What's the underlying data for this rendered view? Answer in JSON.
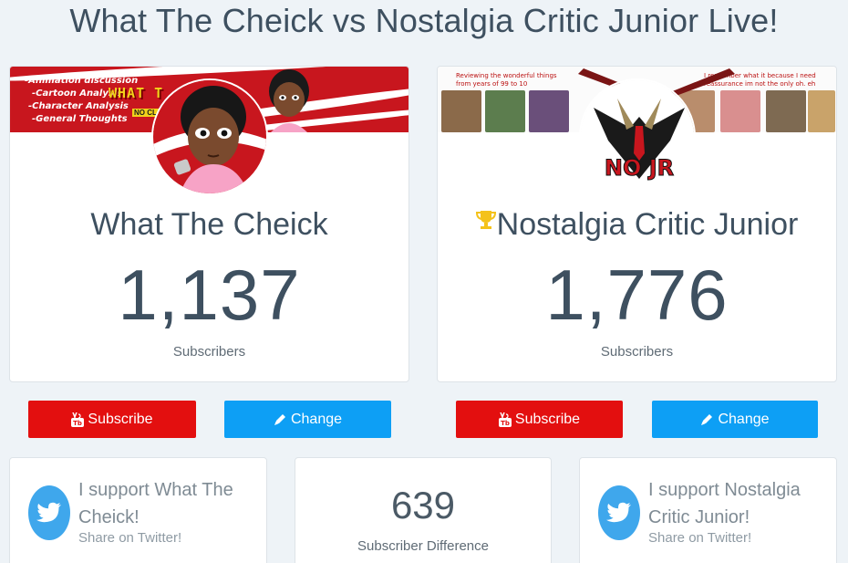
{
  "page": {
    "title": "What The Cheick vs Nostalgia Critic Junior Live!"
  },
  "left_channel": {
    "name": "What The Cheick",
    "subscribers": "1,137",
    "subscribers_label": "Subscribers",
    "banner_lines": [
      "-Animation discussion",
      "-Cartoon Analysis",
      "-Character Analysis",
      "-General Thoughts"
    ],
    "banner_logo": "WHAT T",
    "banner_tag": "NO CL",
    "banner_color": "#c8161e"
  },
  "right_channel": {
    "name": "Nostalgia Critic Junior",
    "subscribers": "1,776",
    "subscribers_label": "Subscribers",
    "badge_icon": "trophy-icon",
    "banner_note_left": "Reviewing the wonderful things from years of 99 to 10",
    "banner_note_right": "I remember what it because I need reassurance im not the only oh. eh",
    "avatar_text": "NO JR"
  },
  "buttons": {
    "subscribe_label": "Subscribe",
    "change_label": "Change",
    "subscribe_color": "#e30f0f",
    "change_color": "#0d9ff5"
  },
  "share_left": {
    "text": "I support What The Cheick!",
    "link": "Share on Twitter!"
  },
  "difference": {
    "value": "639",
    "label": "Subscriber Difference"
  },
  "share_right": {
    "text": "I support Nostalgia Critic Junior!",
    "link": "Share on Twitter!"
  },
  "colors": {
    "background": "#eef3f7",
    "text": "#3e5060",
    "twitter": "#3fa7ec"
  }
}
